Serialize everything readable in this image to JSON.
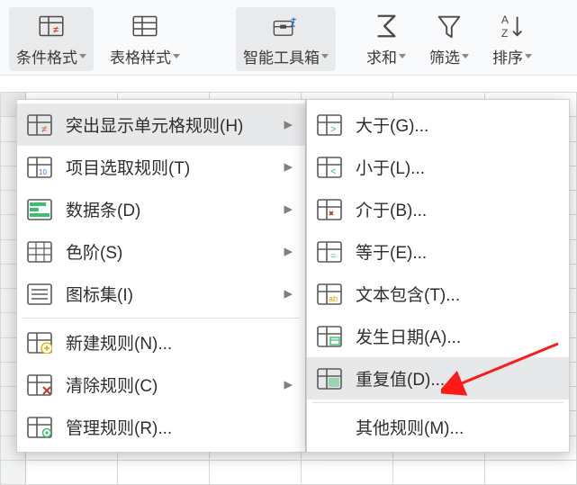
{
  "ribbon": {
    "cond_format": "条件格式",
    "table_style": "表格样式",
    "smart_toolbox": "智能工具箱",
    "sum": "求和",
    "filter": "筛选",
    "sort": "排序"
  },
  "menu_left": {
    "highlight": "突出显示单元格规则(H)",
    "top_rules": "项目选取规则(T)",
    "data_bars": "数据条(D)",
    "color_scales": "色阶(S)",
    "icon_sets": "图标集(I)",
    "new_rule": "新建规则(N)...",
    "clear_rules": "清除规则(C)",
    "manage_rules": "管理规则(R)..."
  },
  "menu_right": {
    "greater": "大于(G)...",
    "less": "小于(L)...",
    "between": "介于(B)...",
    "equal": "等于(E)...",
    "text_contains": "文本包含(T)...",
    "date": "发生日期(A)...",
    "duplicate": "重复值(D)...",
    "other": "其他规则(M)..."
  }
}
